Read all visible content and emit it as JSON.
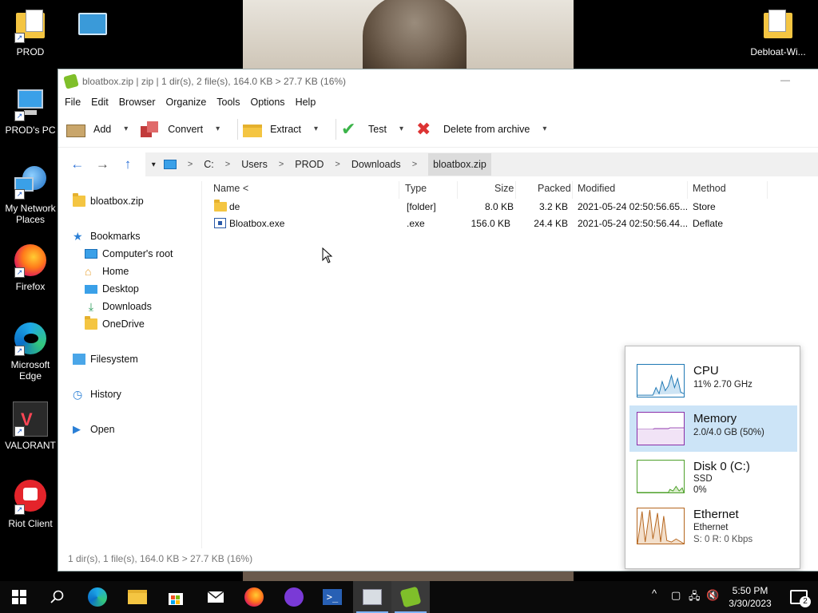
{
  "desktop": {
    "icons": [
      {
        "label": "PROD"
      },
      {
        "label": "PROD's PC"
      },
      {
        "label": "My Network Places"
      },
      {
        "label": "Firefox"
      },
      {
        "label": "Microsoft Edge"
      },
      {
        "label": "VALORANT"
      },
      {
        "label": "Riot Client"
      },
      {
        "label": "Debloat-Wi..."
      }
    ]
  },
  "window": {
    "title": "bloatbox.zip | zip | 1 dir(s), 2 file(s), 164.0 KB > 27.7 KB (16%)",
    "minimize": "—",
    "menu": [
      "File",
      "Edit",
      "Browser",
      "Organize",
      "Tools",
      "Options",
      "Help"
    ],
    "toolbar": {
      "add": "Add",
      "convert": "Convert",
      "extract": "Extract",
      "test": "Test",
      "delete": "Delete from archive",
      "dropdown": "▾"
    },
    "nav": {
      "back": "←",
      "forward": "→",
      "up": "↑",
      "history": "▾"
    },
    "breadcrumb": [
      "C:",
      "Users",
      "PROD",
      "Downloads",
      "bloatbox.zip"
    ],
    "breadcrumb_sep": ">",
    "sidebar": {
      "archive": "bloatbox.zip",
      "bookmarks": "Bookmarks",
      "bookmark_items": [
        "Computer's root",
        "Home",
        "Desktop",
        "Downloads",
        "OneDrive"
      ],
      "filesystem": "Filesystem",
      "history": "History",
      "open": "Open"
    },
    "columns": {
      "name": "Name <",
      "type": "Type",
      "size": "Size",
      "packed": "Packed",
      "modified": "Modified",
      "method": "Method"
    },
    "rows": [
      {
        "name": "de",
        "type": "[folder]",
        "size": "8.0 KB",
        "packed": "3.2 KB",
        "modified": "2021-05-24 02:50:56.65...",
        "method": "Store"
      },
      {
        "name": "Bloatbox.exe",
        "type": ".exe",
        "size": "156.0 KB",
        "packed": "24.4 KB",
        "modified": "2021-05-24 02:50:56.44...",
        "method": "Deflate"
      }
    ],
    "status": "1 dir(s), 1 file(s), 164.0 KB > 27.7 KB (16%)"
  },
  "performance": {
    "items": [
      {
        "name": "CPU",
        "line1": "11%  2.70 GHz",
        "line2": "",
        "color": "#1f78b4"
      },
      {
        "name": "Memory",
        "line1": "2.0/4.0 GB (50%)",
        "line2": "",
        "color": "#8a2ea8"
      },
      {
        "name": "Disk 0 (C:)",
        "line1": "SSD",
        "line2": "0%",
        "color": "#4da02a"
      },
      {
        "name": "Ethernet",
        "line1": "Ethernet",
        "line2": "S: 0  R: 0 Kbps",
        "color": "#b5651d"
      }
    ],
    "selected": 1
  },
  "taskbar": {
    "time": "5:50 PM",
    "date": "3/30/2023",
    "notifications": "2",
    "chevron": "^"
  }
}
